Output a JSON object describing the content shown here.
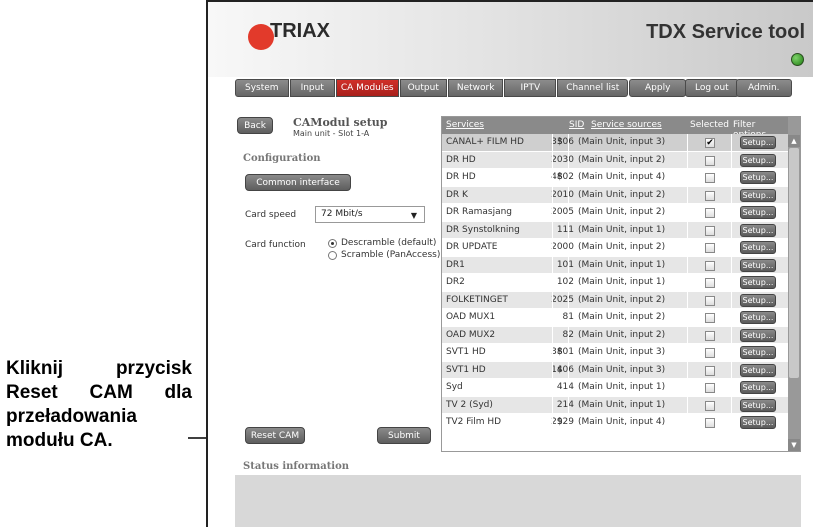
{
  "annotation": {
    "lines": [
      "Kliknij przycisk",
      "Reset CAM dla",
      "przeładowania",
      "modułu CA."
    ]
  },
  "header": {
    "logo_text": "TRIAX",
    "title": "TDX Service tool",
    "status_led_color": "#3a9a26"
  },
  "nav": {
    "tabs": [
      {
        "label": "System"
      },
      {
        "label": "Input"
      },
      {
        "label": "CA Modules"
      },
      {
        "label": "Output"
      },
      {
        "label": "Network"
      },
      {
        "label": "IPTV"
      },
      {
        "label": "Channel list"
      }
    ],
    "active_tab": "CA Modules",
    "apply_label": "Apply",
    "logout_label": "Log out",
    "admin_label": "Admin."
  },
  "left": {
    "back_label": "Back",
    "title": "CAModul setup",
    "subtitle": "Main unit - Slot 1-A",
    "configuration_label": "Configuration",
    "common_interface_label": "Common interface",
    "card_speed_label": "Card speed",
    "card_speed_value": "72 Mbit/s",
    "card_function_label": "Card function",
    "card_function_options": [
      "Descramble (default)",
      "Scramble (PanAccess)"
    ],
    "card_function_selected": "Descramble (default)",
    "reset_label": "Reset CAM",
    "submit_label": "Submit"
  },
  "services_table": {
    "headers": {
      "services": "Services",
      "sid": "SID",
      "sources": "Service sources",
      "selected": "Selected",
      "filter": "Filter options"
    },
    "setup_label": "Setup...",
    "rows": [
      {
        "service": "CANAL+ FILM HD",
        "enc": "$",
        "sid": "3306",
        "source": "(Main Unit, input 3)",
        "selected": true
      },
      {
        "service": "DR HD",
        "enc": "",
        "sid": "2030",
        "source": "(Main Unit, input 2)",
        "selected": false
      },
      {
        "service": "DR HD",
        "enc": "$",
        "sid": "4802",
        "source": "(Main Unit, input 4)",
        "selected": false
      },
      {
        "service": "DR K",
        "enc": "",
        "sid": "2010",
        "source": "(Main Unit, input 2)",
        "selected": false
      },
      {
        "service": "DR Ramasjang",
        "enc": "",
        "sid": "2005",
        "source": "(Main Unit, input 2)",
        "selected": false
      },
      {
        "service": "DR Synstolkning",
        "enc": "",
        "sid": "111",
        "source": "(Main Unit, input 1)",
        "selected": false
      },
      {
        "service": "DR UPDATE",
        "enc": "",
        "sid": "2000",
        "source": "(Main Unit, input 2)",
        "selected": false
      },
      {
        "service": "DR1",
        "enc": "",
        "sid": "101",
        "source": "(Main Unit, input 1)",
        "selected": false
      },
      {
        "service": "DR2",
        "enc": "",
        "sid": "102",
        "source": "(Main Unit, input 1)",
        "selected": false
      },
      {
        "service": "FOLKETINGET",
        "enc": "",
        "sid": "2025",
        "source": "(Main Unit, input 2)",
        "selected": false
      },
      {
        "service": "OAD MUX1",
        "enc": "",
        "sid": "81",
        "source": "(Main Unit, input 2)",
        "selected": false
      },
      {
        "service": "OAD MUX2",
        "enc": "",
        "sid": "82",
        "source": "(Main Unit, input 2)",
        "selected": false
      },
      {
        "service": "SVT1 HD",
        "enc": "$",
        "sid": "3801",
        "source": "(Main Unit, input 3)",
        "selected": false
      },
      {
        "service": "SVT1 HD",
        "enc": "$",
        "sid": "1406",
        "source": "(Main Unit, input 3)",
        "selected": false
      },
      {
        "service": "Syd",
        "enc": "",
        "sid": "414",
        "source": "(Main Unit, input 1)",
        "selected": false
      },
      {
        "service": "TV 2 (Syd)",
        "enc": "",
        "sid": "214",
        "source": "(Main Unit, input 1)",
        "selected": false
      },
      {
        "service": "TV2 Film HD",
        "enc": "$",
        "sid": "2929",
        "source": "(Main Unit, input 4)",
        "selected": false
      }
    ]
  },
  "status": {
    "heading": "Status information"
  },
  "colors": {
    "accent_red": "#c0281f",
    "button_gray": "#6e6e6e",
    "table_header": "#8a8a8a"
  }
}
